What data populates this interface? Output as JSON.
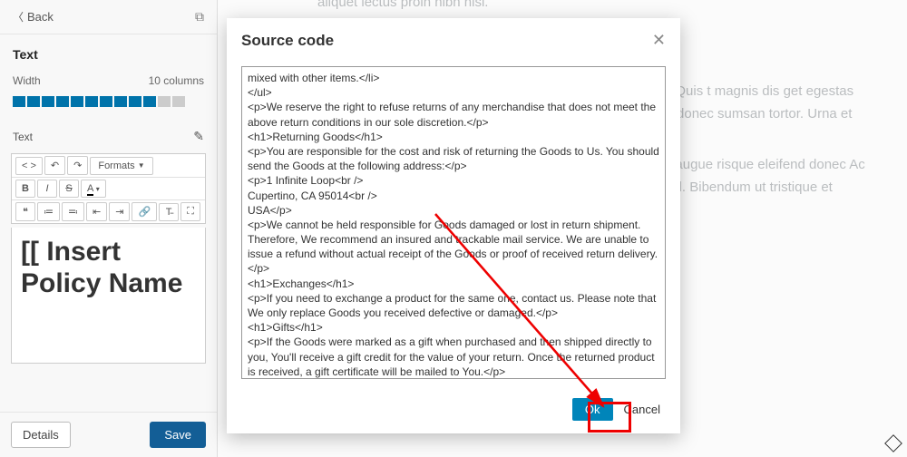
{
  "sidebar": {
    "back": "Back",
    "panel_title": "Text",
    "width_label": "Width",
    "columns_label": "10 columns",
    "section_label": "Text",
    "details": "Details",
    "save": "Save"
  },
  "toolbar": {
    "code": "< >",
    "undo": "↶",
    "redo": "↷",
    "formats": "Formats",
    "bold": "B",
    "italic": "I",
    "strike": "S",
    "color": "A",
    "blockquote": "❝",
    "ul": "≔",
    "ol": "≕",
    "outdent": "⇤",
    "indent": "⇥",
    "link": "🔗",
    "clear": "T̵",
    "fullscreen": "⛶"
  },
  "editor_preview": "[[ Insert Policy Name",
  "modal": {
    "title": "Source code",
    "ok": "Ok",
    "cancel": "Cancel",
    "source": "mixed with other items.</li>\n</ul>\n<p>We reserve the right to refuse returns of any merchandise that does not meet the above return conditions in our sole discretion.</p>\n<h1>Returning Goods</h1>\n<p>You are responsible for the cost and risk of returning the Goods to Us. You should send the Goods at the following address:</p>\n<p>1 Infinite Loop<br />\nCupertino, CA 95014<br />\nUSA</p>\n<p>We cannot be held responsible for Goods damaged or lost in return shipment. Therefore, We recommend an insured and trackable mail service. We are unable to issue a refund without actual receipt of the Goods or proof of received return delivery.</p>\n<h1>Exchanges</h1>\n<p>If you need to exchange a product for the same one, contact us. Please note that We only replace Goods you received defective or damaged.</p>\n<h1>Gifts</h1>\n<p>If the Goods were marked as a gift when purchased and then shipped directly to you, You'll receive a gift credit for the value of your return. Once the returned product is received, a gift certificate will be mailed to You.</p>\n<p>If the Goods weren't marked as a gift when purchased, or the gift giver had the Order shipped to themselves to give it to You later, We will send the refund to the gift giver.</p>\n<h2>Contact Us</h2>\n<p>If you have any questions about our Returns and Refunds Policy, please contact us:</p>\n<ul>\n<li>By email: office@termsfeed.com</li>\n</ul>"
  },
  "body_text": {
    "top": "aliquet lectus proin nibh nisl.",
    "mid": "eiusmod tempor pit adipiscing orbi enim nunc is nunc eget. Quis t magnis dis get egestas purus eget dolor morbi non rem mollis. Non ia quis vel eros donec sumsan tortor. Urna et",
    "bot": "npus egestas sed. Ante unc pulvinar sapien et t vivamus at augue risque eleifend donec Ac felis donec et odio pellentesque diam volutpat commodo sed. Bibendum ut tristique et egestas. Dui id"
  }
}
